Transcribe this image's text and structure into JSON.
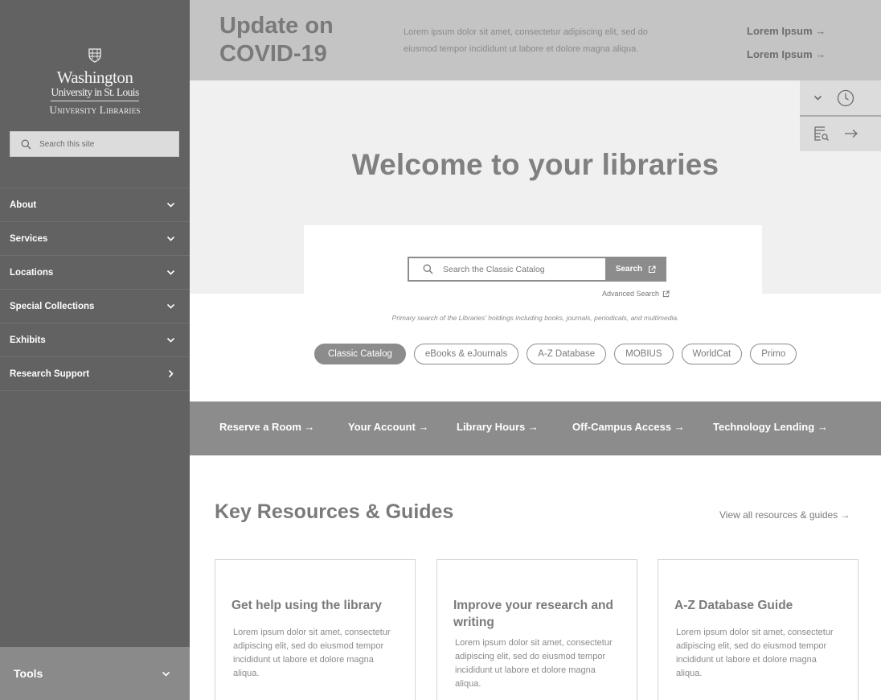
{
  "sidebar": {
    "logo": {
      "line1": "Washington",
      "line2": "University in St. Louis",
      "line3": "University Libraries"
    },
    "search": {
      "placeholder": "Search this site"
    },
    "items": [
      {
        "label": "About",
        "chevron": "chevron-down-icon"
      },
      {
        "label": "Services",
        "chevron": "chevron-down-icon"
      },
      {
        "label": "Locations",
        "chevron": "chevron-down-icon"
      },
      {
        "label": "Special Collections",
        "chevron": "chevron-down-icon"
      },
      {
        "label": "Exhibits",
        "chevron": "chevron-down-icon"
      },
      {
        "label": "Research Support",
        "chevron": "chevron-right-icon"
      }
    ],
    "tools_label": "Tools"
  },
  "alert": {
    "title": "Update on COVID-19",
    "text": "Lorem ipsum dolor sit amet, consectetur adipiscing elit, sed do eiusmod tempor incididunt ut labore et dolore magna aliqua.",
    "links": [
      "Lorem Ipsum →",
      "Lorem Ipsum →"
    ]
  },
  "hero": {
    "title": "Welcome to your libraries",
    "utility_icons": [
      "chevron-down-icon",
      "clock-icon",
      "list-search-icon",
      "arrow-right-icon"
    ]
  },
  "catalog": {
    "placeholder": "Search the Classic Catalog",
    "button_label": "Search",
    "advanced_label": "Advanced Search",
    "caption": "Primary search of the Libraries' holdings including books, journals, periodicals, and multimedia.",
    "tabs": [
      "Classic Catalog",
      "eBooks & eJournals",
      "A-Z Database",
      "MOBIUS",
      "WorldCat",
      "Primo"
    ],
    "active_tab": "Classic Catalog"
  },
  "quick_links": [
    "Reserve a Room →",
    "Your Account →",
    "Library Hours →",
    "Off-Campus Access →",
    "Technology Lending →"
  ],
  "resources": {
    "title": "Key Resources & Guides",
    "view_all": "View all resources & guides →",
    "cards": [
      {
        "title": "Get help using the library",
        "text": "Lorem ipsum dolor sit amet, consectetur adipiscing elit, sed do eiusmod tempor incididunt ut labore et dolore magna aliqua."
      },
      {
        "title": "Improve your research and writing",
        "text": "Lorem ipsum dolor sit amet, consectetur adipiscing elit, sed do eiusmod tempor incididunt ut labore et dolore magna aliqua."
      },
      {
        "title": "A-Z Database Guide",
        "text": "Lorem ipsum dolor sit amet, consectetur adipiscing elit, sed do eiusmod tempor incididunt ut labore et dolore magna aliqua."
      }
    ]
  },
  "colors": {
    "sidebar": "#626262",
    "alert_bg": "#c4c4c4",
    "hero_bg": "#f0f0f0",
    "band": "#8c8c8c"
  }
}
